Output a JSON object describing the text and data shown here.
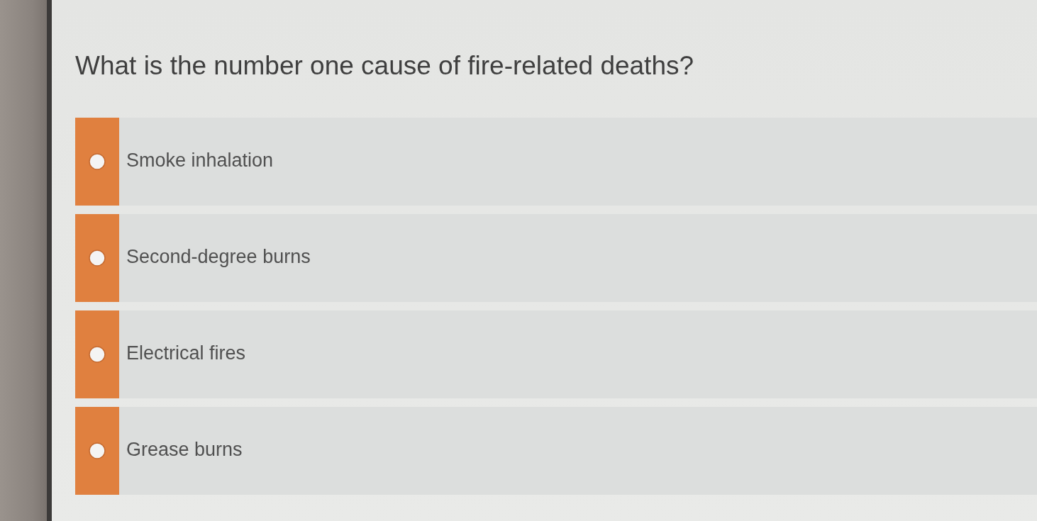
{
  "question": "What is the number one cause of fire-related deaths?",
  "options": [
    {
      "label": "Smoke inhalation",
      "selected": false
    },
    {
      "label": "Second-degree burns",
      "selected": false
    },
    {
      "label": "Electrical fires",
      "selected": false
    },
    {
      "label": "Grease burns",
      "selected": false
    }
  ]
}
